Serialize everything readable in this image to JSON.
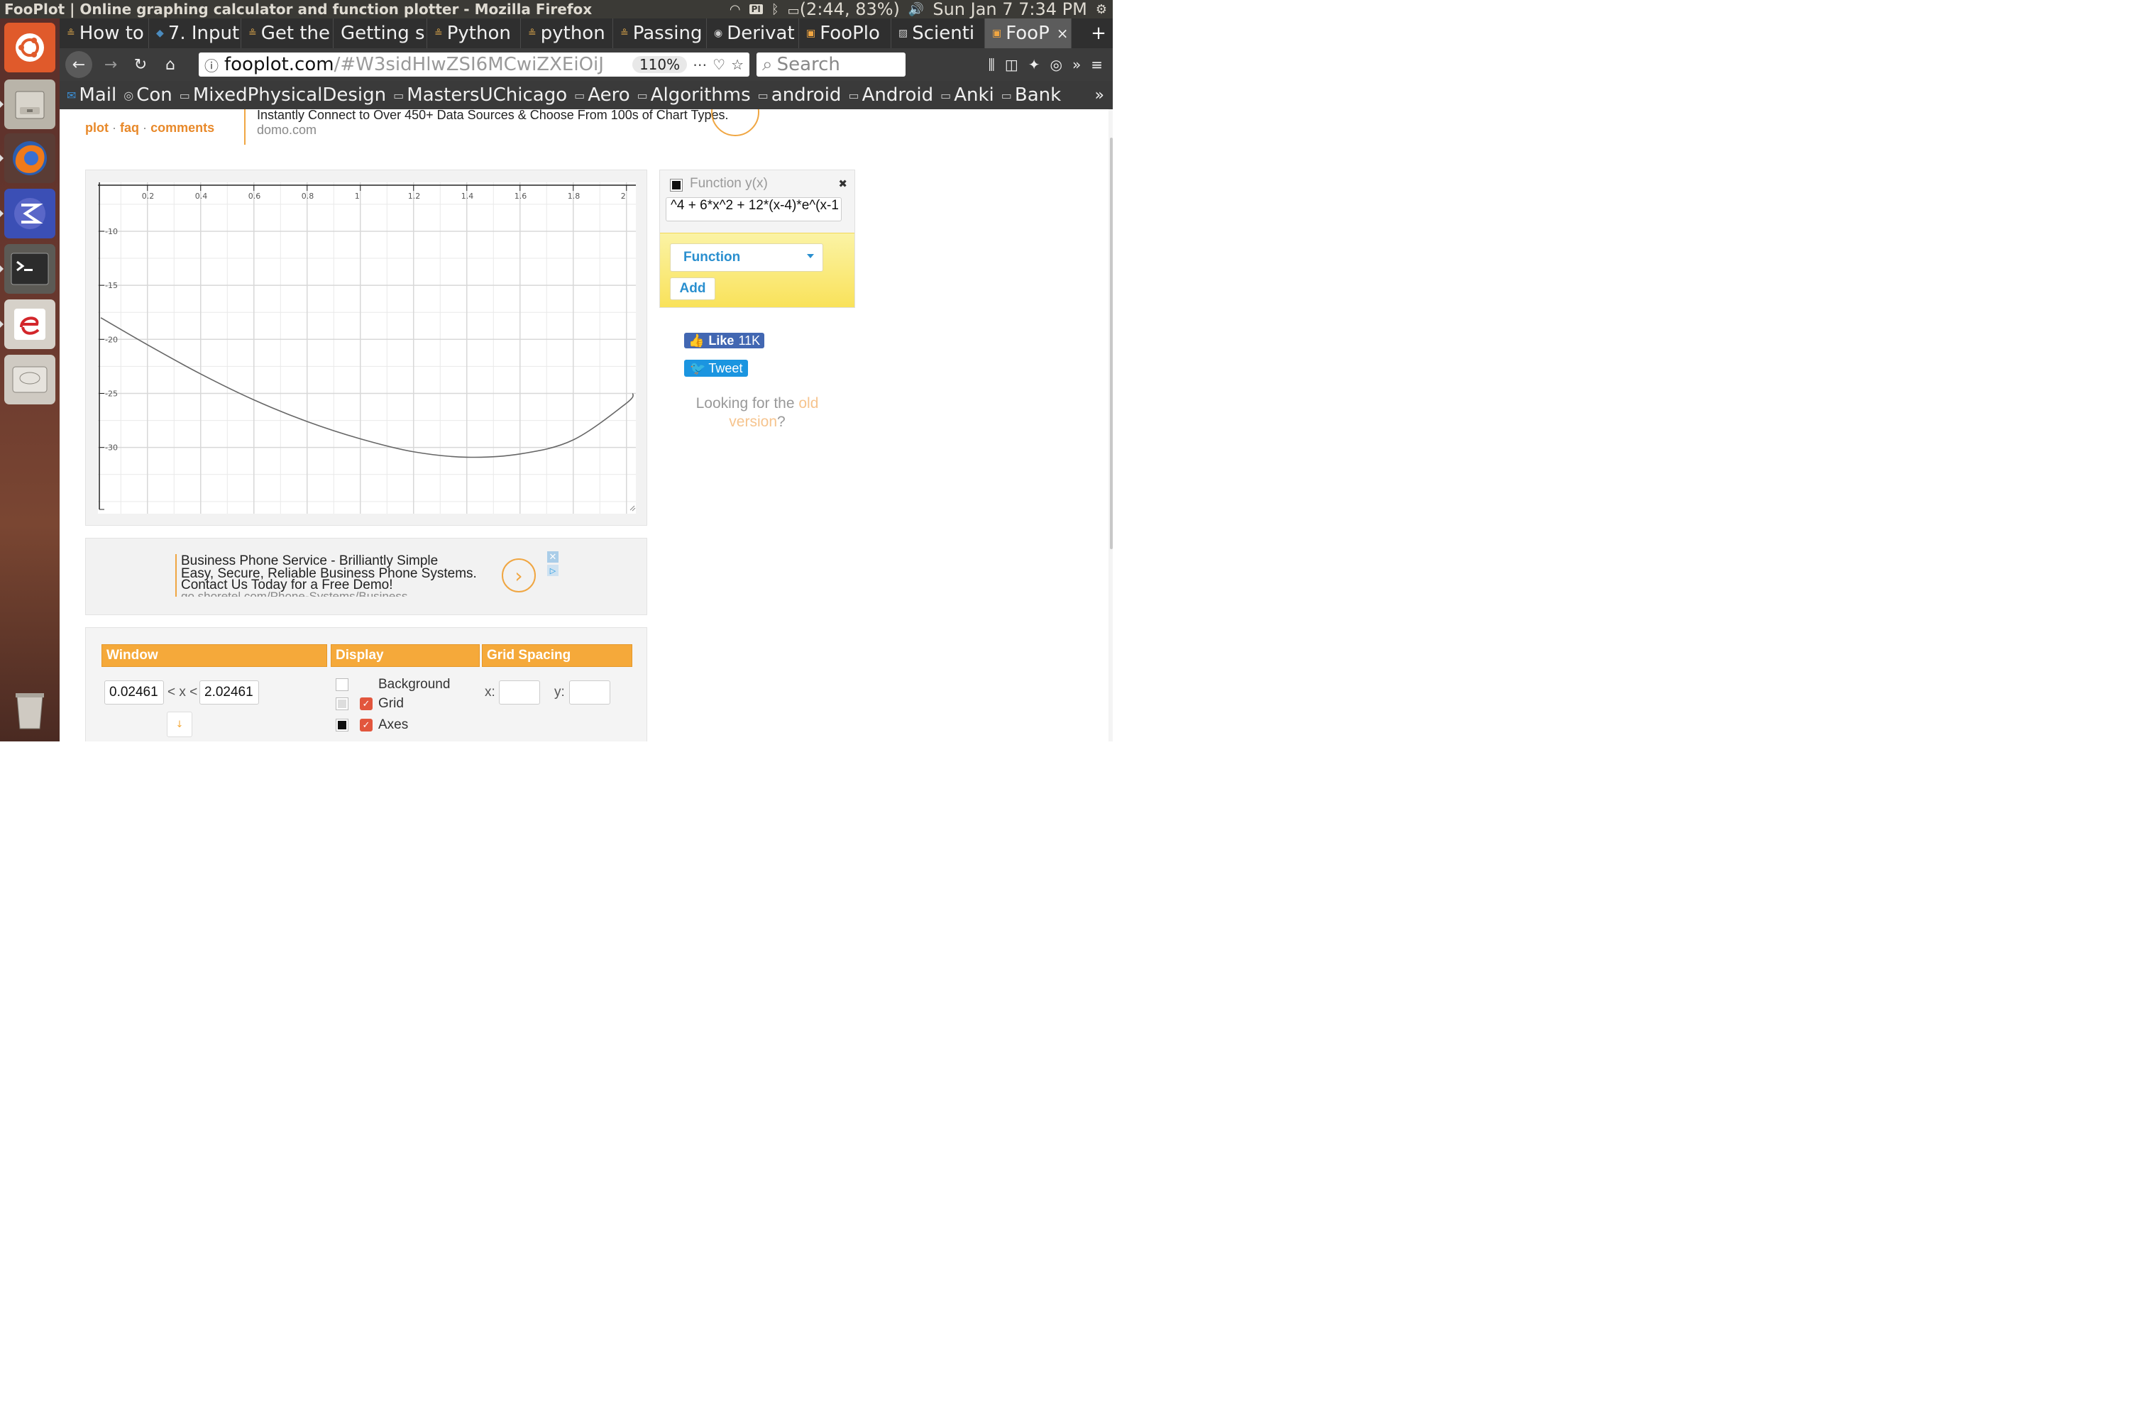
{
  "window_title": "FooPlot | Online graphing calculator and function plotter - Mozilla Firefox",
  "system_tray": {
    "keyboard": "PI",
    "battery": "(2:44, 83%)",
    "datetime": "Sun Jan  7  7:34 PM"
  },
  "tabs": [
    {
      "title": "How to",
      "active": false
    },
    {
      "title": "7. Input",
      "active": false
    },
    {
      "title": "Get the",
      "active": false
    },
    {
      "title": "Getting s",
      "active": false
    },
    {
      "title": "Python",
      "active": false
    },
    {
      "title": "python",
      "active": false
    },
    {
      "title": "Passing",
      "active": false
    },
    {
      "title": "Derivat",
      "active": false
    },
    {
      "title": "FooPlo",
      "active": false
    },
    {
      "title": "Scienti",
      "active": false
    },
    {
      "title": "FooP",
      "active": true
    }
  ],
  "address_bar": {
    "host": "fooplot.com",
    "path": "/#W3sidHlwZSI6MCwiZXEiOiJ",
    "zoom": "110%"
  },
  "search_placeholder": "Search",
  "bookmarks": [
    "Mail",
    "Con",
    "MixedPhysicalDesign",
    "MastersUChicago",
    "Aero",
    "Algorithms",
    "android",
    "Android",
    "Anki",
    "Bank"
  ],
  "site_nav": {
    "plot": "plot",
    "faq": "faq",
    "comments": "comments",
    "sep": "·"
  },
  "top_ad": {
    "text": "Instantly Connect to Over 450+ Data Sources & Choose From 100s of Chart Types.",
    "domain": "domo.com"
  },
  "function_panel": {
    "label": "Function y(x)",
    "expression": "^4 + 6*x^2 + 12*(x-4)*e^(x-1",
    "color": "#111111",
    "type_selected": "Function",
    "add_label": "Add"
  },
  "social": {
    "like_label": "Like",
    "like_count": "11K",
    "tweet_label": "Tweet"
  },
  "old_version": {
    "pre": "Looking for the ",
    "link": "old version",
    "post": "?"
  },
  "mid_ad": {
    "title": "Business Phone Service - Brilliantly Simple",
    "desc1": "Easy, Secure, Reliable Business Phone Systems.",
    "desc2": "Contact Us Today for a Free Demo!",
    "url": "go.shoretel.com/Phone-Systems/Business"
  },
  "settings": {
    "window_header": "Window",
    "display_header": "Display",
    "grid_header": "Grid Spacing",
    "xmin": "0.02461",
    "xmax": "2.02461",
    "between": "< x <",
    "display_items": [
      {
        "label": "Background",
        "checked": false,
        "swatch": "#ffffff"
      },
      {
        "label": "Grid",
        "checked": true,
        "swatch": "#dddddd"
      },
      {
        "label": "Axes",
        "checked": true,
        "swatch": "#111111"
      }
    ],
    "grid_x_label": "x:",
    "grid_y_label": "y:",
    "grid_x_value": "",
    "grid_y_value": ""
  },
  "chart_data": {
    "type": "line",
    "x_ticks": [
      "0.2",
      "0.4",
      "0.6",
      "0.8",
      "1",
      "1.2",
      "1.4",
      "1.6",
      "1.8",
      "2"
    ],
    "y_ticks": [
      "-10",
      "-15",
      "-20",
      "-25",
      "-30"
    ],
    "xlim": [
      0.02461,
      2.02461
    ],
    "ylim": [
      -35.6,
      -6.0
    ],
    "grid": true,
    "series": [
      {
        "color": "#666666",
        "x": [
          0.02461,
          0.2,
          0.4,
          0.6,
          0.8,
          1.0,
          1.2,
          1.4,
          1.6,
          1.8,
          2.0,
          2.02461
        ],
        "y": [
          -18.0,
          -20.5,
          -23.2,
          -25.6,
          -27.6,
          -29.2,
          -30.4,
          -30.9,
          -30.6,
          -29.3,
          -25.9,
          -25.0
        ]
      }
    ]
  }
}
